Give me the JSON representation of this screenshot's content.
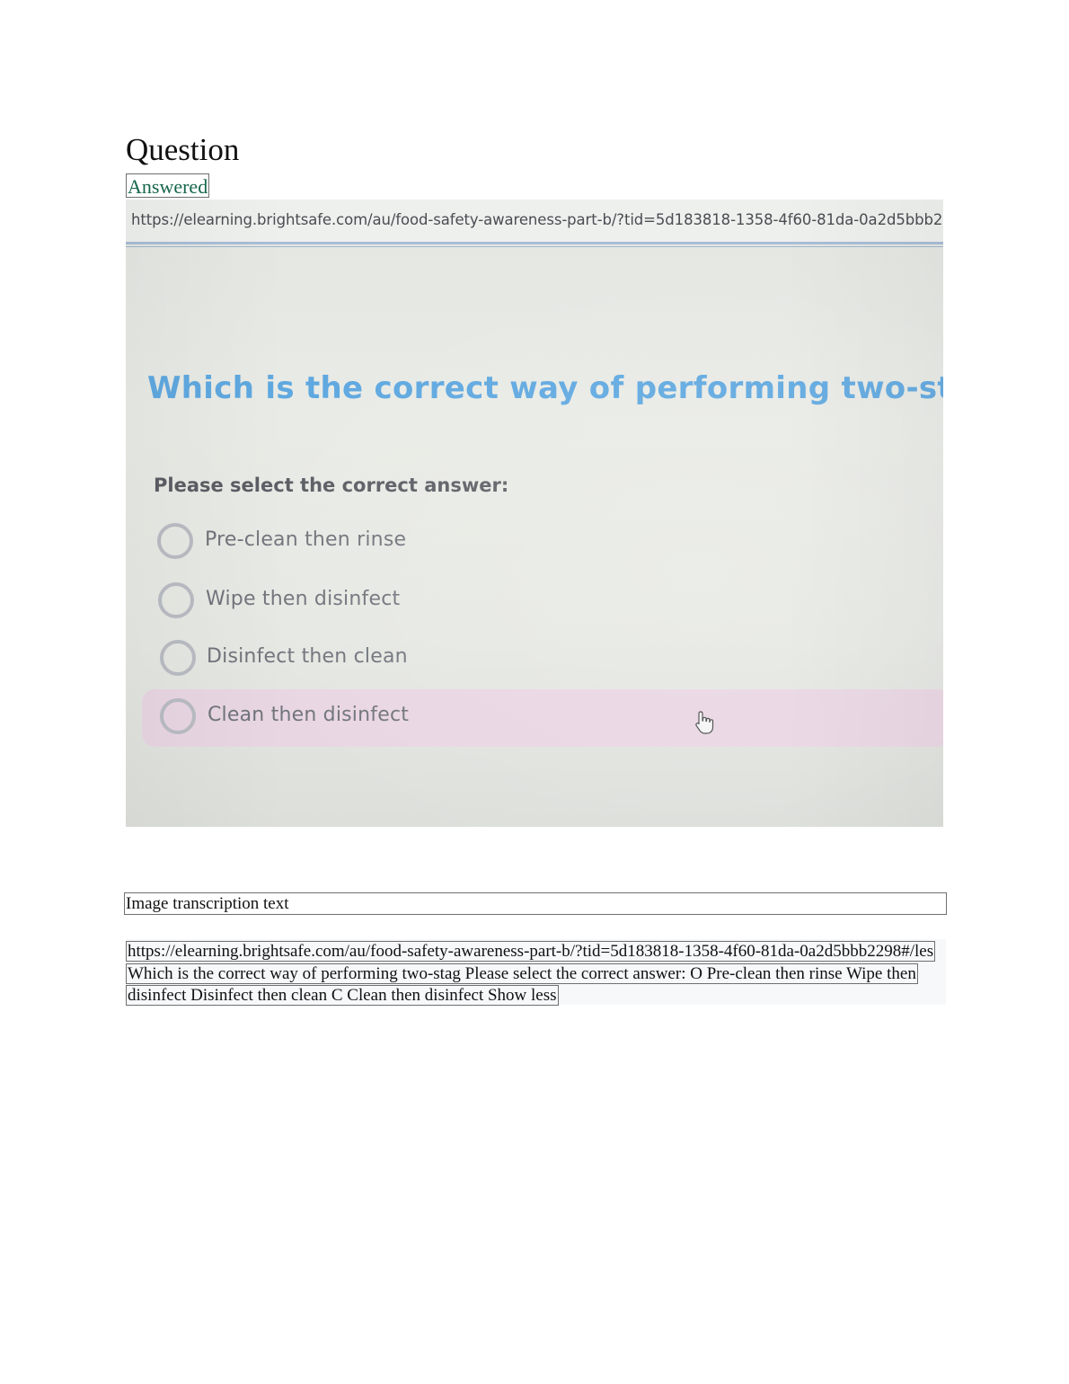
{
  "page": {
    "title": "Question",
    "status_badge": "Answered"
  },
  "photo": {
    "url": "https://elearning.brightsafe.com/au/food-safety-awareness-part-b/?tid=5d183818-1358-4f60-81da-0a2d5bbb2298#/les",
    "question_heading": "Which is the correct way of performing two-stag",
    "prompt": "Please select the correct answer:",
    "options": [
      {
        "label": "Pre-clean then rinse",
        "highlighted": false
      },
      {
        "label": "Wipe then disinfect",
        "highlighted": false
      },
      {
        "label": "Disinfect then clean",
        "highlighted": false
      },
      {
        "label": "Clean then disinfect",
        "highlighted": true
      }
    ],
    "colors": {
      "heading": "#5fa8e0",
      "highlight": "#e9d6e3",
      "radio_border": "#b9bcc3"
    },
    "icons": [
      "hand-pointer-icon"
    ]
  },
  "transcription": {
    "label": "Image transcription text",
    "text": "https://elearning.brightsafe.com/au/food-safety-awareness-part-b/?tid=5d183818-1358-4f60-81da-0a2d5bbb2298#/les Which is the correct way of performing two-stag Please select the correct answer: O Pre-clean then rinse Wipe then disinfect Disinfect then clean C Clean then disinfect Show less"
  }
}
